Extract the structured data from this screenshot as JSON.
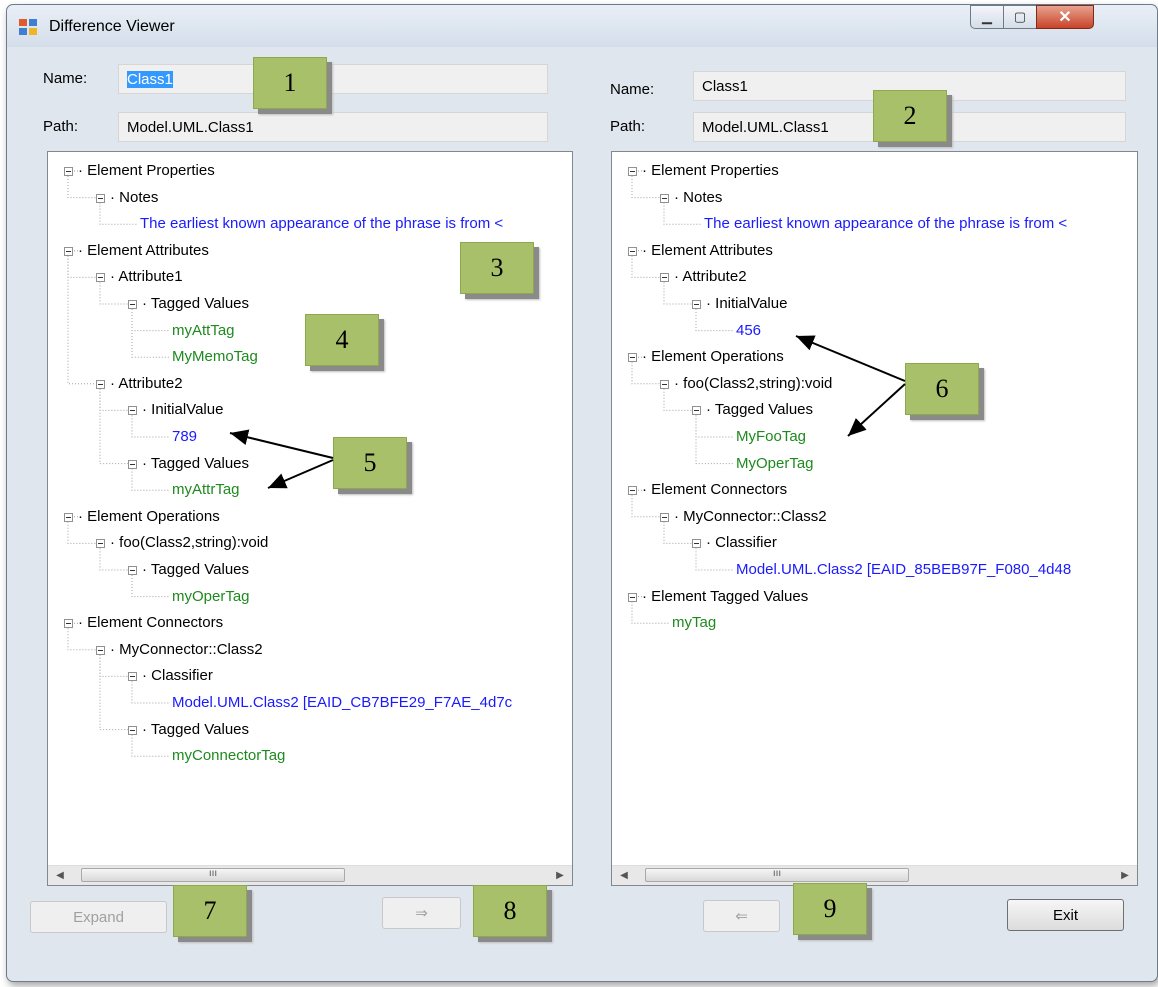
{
  "window": {
    "title": "Difference Viewer",
    "icons": [
      "app-icon",
      "minimize-icon",
      "maximize-icon",
      "close-icon"
    ]
  },
  "left": {
    "name_label": "Name:",
    "name_value": "Class1",
    "path_label": "Path:",
    "path_value": "Model.UML.Class1",
    "tree": [
      {
        "text": "Element Properties",
        "color": "black",
        "expander": true
      },
      {
        "text": "Notes",
        "color": "black",
        "expander": true
      },
      {
        "text": "The earliest known appearance of the phrase is from <",
        "color": "blue"
      },
      {
        "text": "Element Attributes",
        "color": "black",
        "expander": true
      },
      {
        "text": "Attribute1",
        "color": "black",
        "expander": true
      },
      {
        "text": "Tagged Values",
        "color": "black",
        "expander": true
      },
      {
        "text": "myAttTag",
        "color": "green"
      },
      {
        "text": "MyMemoTag",
        "color": "green"
      },
      {
        "text": "Attribute2",
        "color": "black",
        "expander": true
      },
      {
        "text": "InitialValue",
        "color": "black",
        "expander": true
      },
      {
        "text": "789",
        "color": "blue"
      },
      {
        "text": "Tagged Values",
        "color": "black",
        "expander": true
      },
      {
        "text": "myAttrTag",
        "color": "green"
      },
      {
        "text": "Element Operations",
        "color": "black",
        "expander": true
      },
      {
        "text": "foo(Class2,string):void",
        "color": "black",
        "expander": true
      },
      {
        "text": "Tagged Values",
        "color": "black",
        "expander": true
      },
      {
        "text": "myOperTag",
        "color": "green"
      },
      {
        "text": "Element Connectors",
        "color": "black",
        "expander": true
      },
      {
        "text": "MyConnector::Class2",
        "color": "black",
        "expander": true
      },
      {
        "text": "Classifier",
        "color": "black",
        "expander": true
      },
      {
        "text": "Model.UML.Class2 [EAID_CB7BFE29_F7AE_4d7c",
        "color": "blue"
      },
      {
        "text": "Tagged Values",
        "color": "black",
        "expander": true
      },
      {
        "text": "myConnectorTag",
        "color": "green"
      }
    ],
    "expand_button": "Expand",
    "copy_right_button": "⇒"
  },
  "right": {
    "name_label": "Name:",
    "name_value": "Class1",
    "path_label": "Path:",
    "path_value": "Model.UML.Class1",
    "tree": [
      {
        "text": "Element Properties",
        "color": "black",
        "expander": true
      },
      {
        "text": "Notes",
        "color": "black",
        "expander": true
      },
      {
        "text": "The earliest known appearance of the phrase is from <",
        "color": "blue"
      },
      {
        "text": "Element Attributes",
        "color": "black",
        "expander": true
      },
      {
        "text": "Attribute2",
        "color": "black",
        "expander": true
      },
      {
        "text": "InitialValue",
        "color": "black",
        "expander": true
      },
      {
        "text": "456",
        "color": "blue"
      },
      {
        "text": "Element Operations",
        "color": "black",
        "expander": true
      },
      {
        "text": "foo(Class2,string):void",
        "color": "black",
        "expander": true
      },
      {
        "text": "Tagged Values",
        "color": "black",
        "expander": true
      },
      {
        "text": "MyFooTag",
        "color": "green"
      },
      {
        "text": "MyOperTag",
        "color": "green"
      },
      {
        "text": "Element Connectors",
        "color": "black",
        "expander": true
      },
      {
        "text": "MyConnector::Class2",
        "color": "black",
        "expander": true
      },
      {
        "text": "Classifier",
        "color": "black",
        "expander": true
      },
      {
        "text": "Model.UML.Class2 [EAID_85BEB97F_F080_4d48",
        "color": "blue"
      },
      {
        "text": "Element Tagged Values",
        "color": "black",
        "expander": true
      },
      {
        "text": "myTag",
        "color": "green"
      }
    ],
    "copy_left_button": "⇐",
    "exit_button": "Exit"
  },
  "callouts": [
    "1",
    "2",
    "3",
    "4",
    "5",
    "6",
    "7",
    "8",
    "9"
  ],
  "colors": {
    "blue_text": "#1a1aff",
    "green_text": "#1e8a1e",
    "callout": "#a9c06a",
    "selection": "#3399ff"
  }
}
